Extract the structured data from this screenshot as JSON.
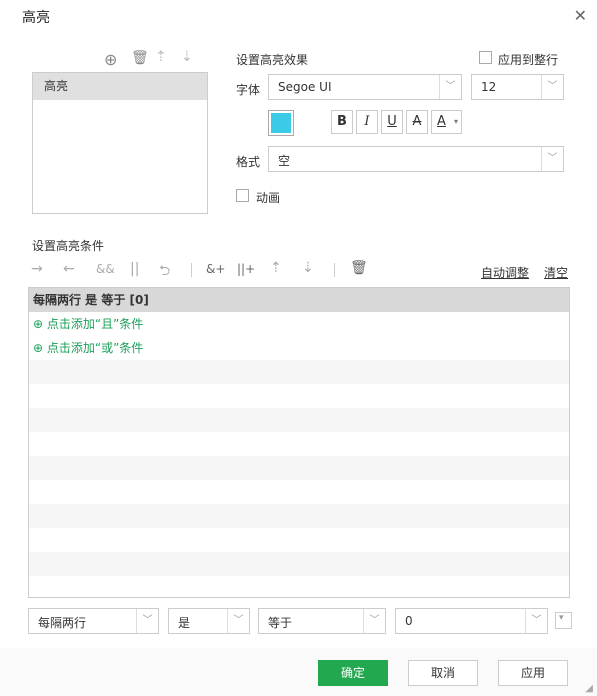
{
  "dialog": {
    "title": "高亮",
    "close_icon": "close-icon"
  },
  "highlight_list": {
    "items": [
      "高亮"
    ]
  },
  "effect": {
    "section_label": "设置高亮效果",
    "apply_row_label": "应用到整行",
    "font_label": "字体",
    "font_value": "Segoe UI",
    "size_value": "12",
    "bold_label": "B",
    "italic_label": "I",
    "underline_label": "U",
    "strike_label": "A",
    "fontcolor_label": "A",
    "highlight_color": "#3ccbe6",
    "format_label": "格式",
    "format_value": "空",
    "animation_label": "动画"
  },
  "conditions": {
    "section_label": "设置高亮条件",
    "auto_adjust_label": "自动调整",
    "clear_label": "清空",
    "rows": [
      "每隔两行 是 等于 [0]",
      "点击添加“且”条件",
      "点击添加“或”条件"
    ]
  },
  "editor": {
    "field_value": "每隔两行",
    "op_value": "是",
    "cmp_value": "等于",
    "val_value": "0"
  },
  "footer": {
    "ok_label": "确定",
    "cancel_label": "取消",
    "apply_label": "应用"
  }
}
